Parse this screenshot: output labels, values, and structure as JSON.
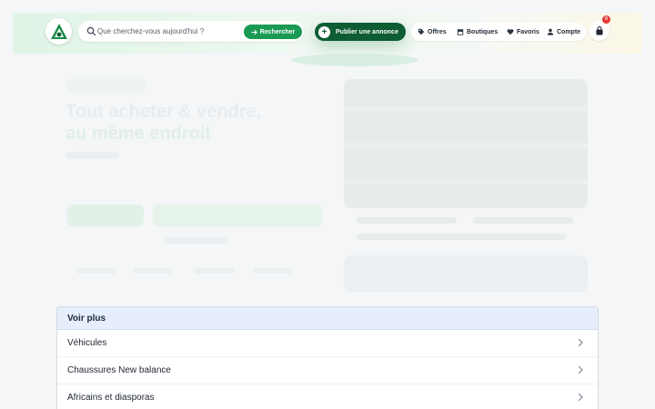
{
  "header": {
    "search": {
      "placeholder": "Que cherchez-vous aujourd'hui ?",
      "button_label": "Rechercher"
    },
    "publish_button": {
      "label": "Publier une annonce"
    },
    "nav": [
      {
        "label": "Offres",
        "icon": "tag-icon"
      },
      {
        "label": "Boutiques",
        "icon": "store-icon"
      },
      {
        "label": "Favoris",
        "icon": "heart-icon"
      },
      {
        "label": "Compte",
        "icon": "user-icon"
      }
    ],
    "cart": {
      "count": "0",
      "icon": "shopping-bag-icon"
    }
  },
  "hero": {
    "title_line1": "Tout acheter & vendre,",
    "title_line2": "au même endroit"
  },
  "dropdown": {
    "header": "Voir plus",
    "items": [
      {
        "label": "Véhicules"
      },
      {
        "label": "Chaussures New balance"
      },
      {
        "label": "Africains et diasporas"
      }
    ]
  },
  "colors": {
    "brand_green": "#1a9a55",
    "dark_green": "#0e5c34",
    "badge_red": "#e53935",
    "dropdown_header_bg": "#e6eefb"
  }
}
